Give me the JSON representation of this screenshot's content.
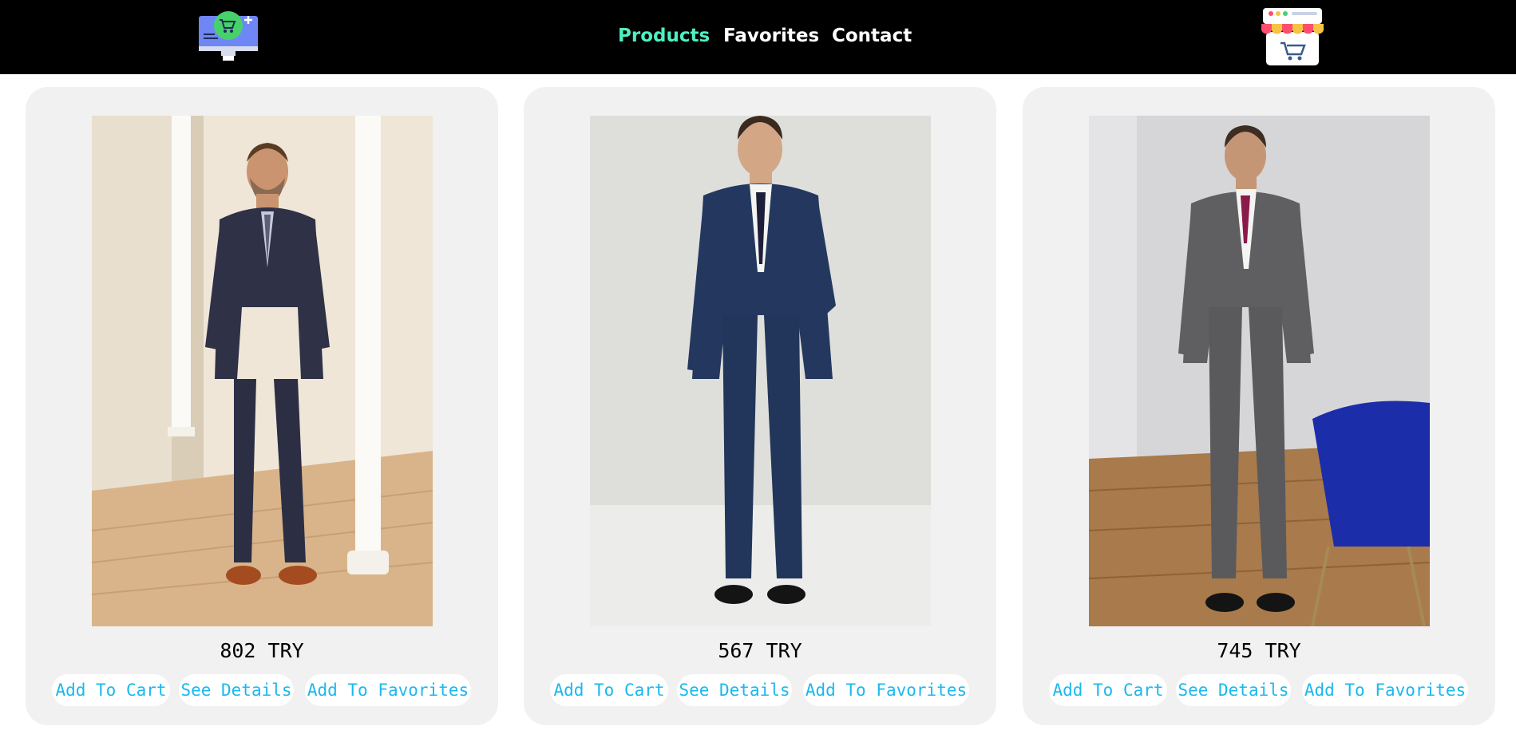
{
  "header": {
    "left_logo_icon": "shopping-cart-monitor-icon",
    "right_logo_icon": "shop-storefront-icon",
    "nav": [
      {
        "label": "Products",
        "active": true
      },
      {
        "label": "Favorites",
        "active": false
      },
      {
        "label": "Contact",
        "active": false
      }
    ],
    "colors": {
      "background": "#000000",
      "active_link": "#4ef0c2",
      "link": "#ffffff"
    }
  },
  "products": [
    {
      "image": "man-in-dark-checked-three-piece-suit-photo",
      "price": "802 TRY",
      "add_to_cart_label": "Add To Cart",
      "see_details_label": "See Details",
      "add_to_favorites_label": "Add To Favorites"
    },
    {
      "image": "man-in-navy-three-piece-suit-photo",
      "price": "567 TRY",
      "add_to_cart_label": "Add To Cart",
      "see_details_label": "See Details",
      "add_to_favorites_label": "Add To Favorites"
    },
    {
      "image": "man-in-grey-three-piece-suit-photo",
      "price": "745 TRY",
      "add_to_cart_label": "Add To Cart",
      "see_details_label": "See Details",
      "add_to_favorites_label": "Add To Favorites"
    }
  ],
  "colors": {
    "card_background": "#f1f1f1",
    "button_text": "#1ab8ee"
  }
}
